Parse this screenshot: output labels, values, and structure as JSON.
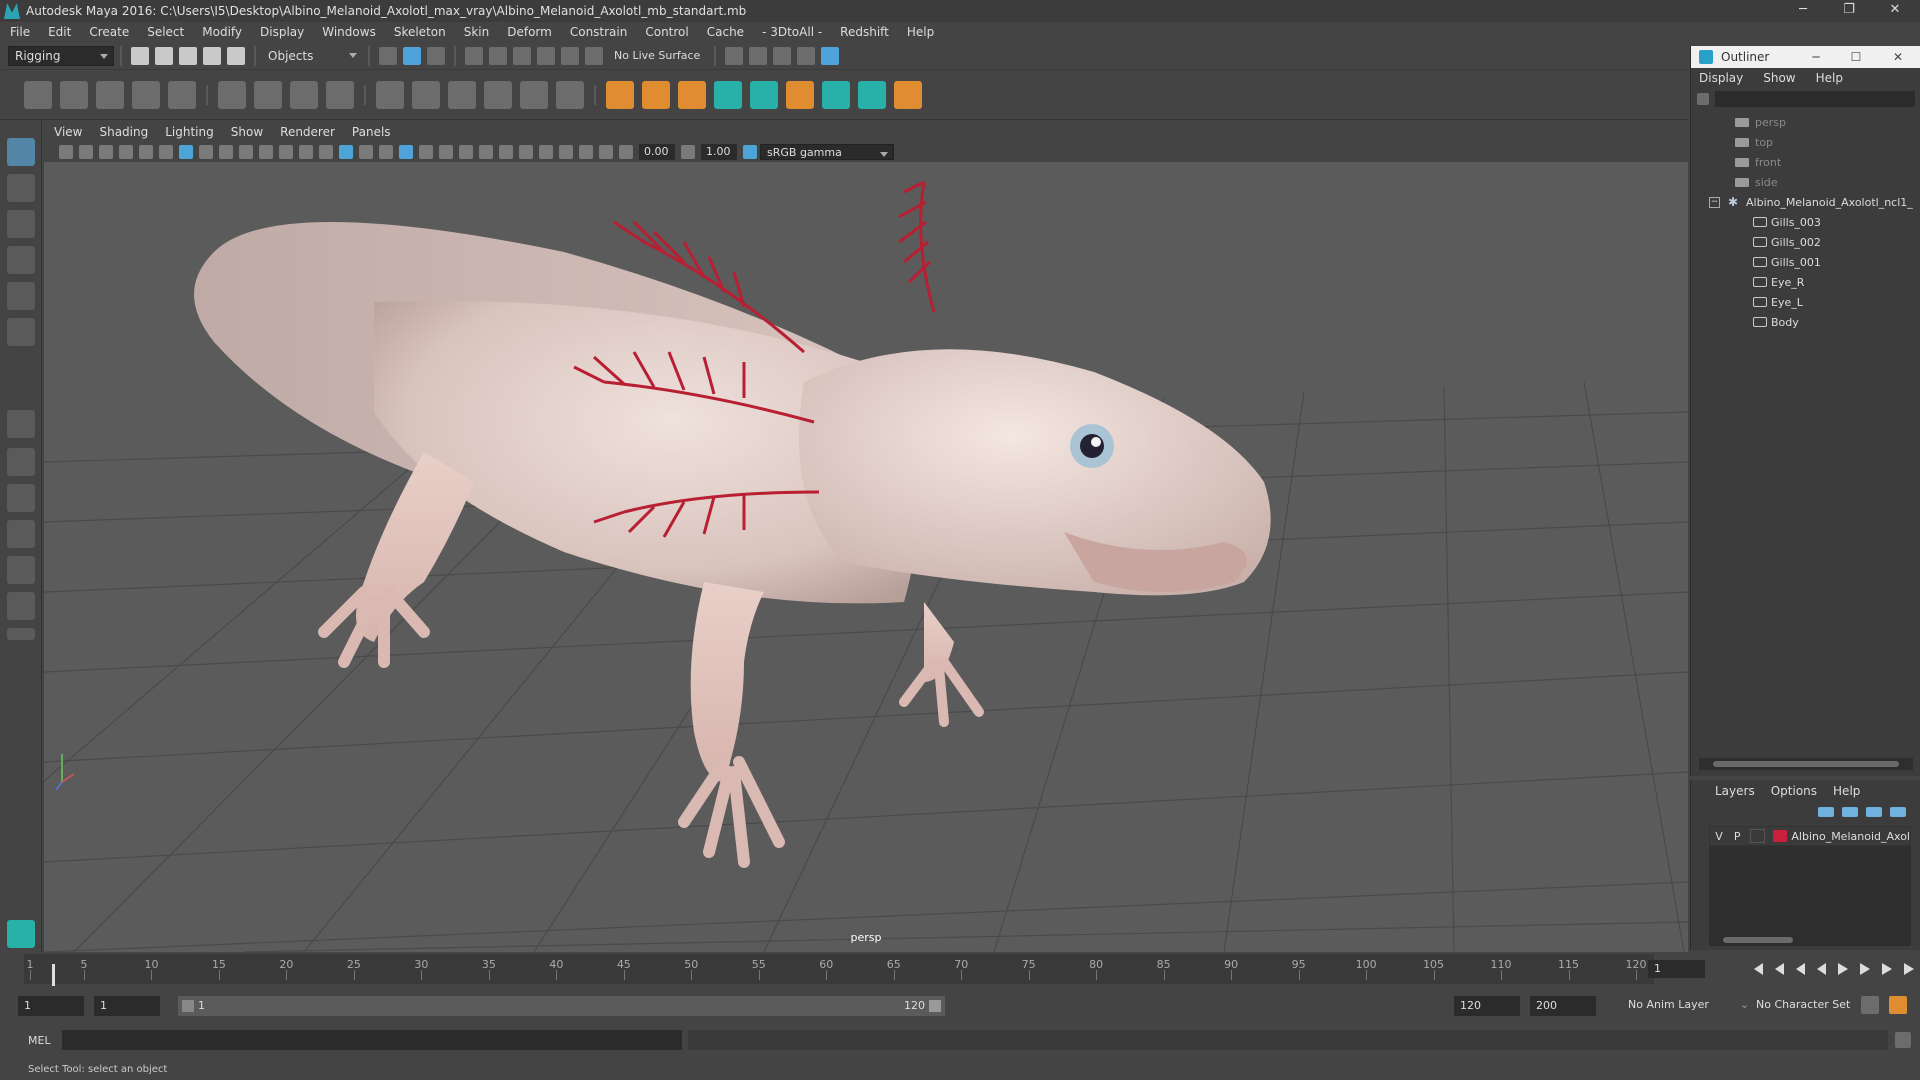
{
  "window": {
    "title": "Autodesk Maya 2016: C:\\Users\\I5\\Desktop\\Albino_Melanoid_Axolotl_max_vray\\Albino_Melanoid_Axolotl_mb_standart.mb",
    "minimize": "─",
    "restore": "❐",
    "close": "✕"
  },
  "menubar": [
    "File",
    "Edit",
    "Create",
    "Select",
    "Modify",
    "Display",
    "Windows",
    "Skeleton",
    "Skin",
    "Deform",
    "Constrain",
    "Control",
    "Cache",
    "- 3DtoAll -",
    "Redshift",
    "Help"
  ],
  "statusline": {
    "menuset": "Rigging",
    "selection_mode": "Objects",
    "live_surface": "No Live Surface"
  },
  "viewport": {
    "menus": [
      "View",
      "Shading",
      "Lighting",
      "Show",
      "Renderer",
      "Panels"
    ],
    "exposure": "0.00",
    "gamma": "1.00",
    "color_space": "sRGB gamma",
    "camera_label": "persp"
  },
  "outliner": {
    "title": "Outliner",
    "menus": [
      "Display",
      "Show",
      "Help"
    ],
    "minimize": "─",
    "maximize": "☐",
    "close": "✕",
    "items": [
      {
        "label": "persp",
        "type": "camera"
      },
      {
        "label": "top",
        "type": "camera"
      },
      {
        "label": "front",
        "type": "camera"
      },
      {
        "label": "side",
        "type": "camera"
      },
      {
        "label": "Albino_Melanoid_Axolotl_ncl1_",
        "type": "group"
      },
      {
        "label": "Gills_003",
        "type": "mesh"
      },
      {
        "label": "Gills_002",
        "type": "mesh"
      },
      {
        "label": "Gills_001",
        "type": "mesh"
      },
      {
        "label": "Eye_R",
        "type": "mesh"
      },
      {
        "label": "Eye_L",
        "type": "mesh"
      },
      {
        "label": "Body",
        "type": "mesh"
      }
    ]
  },
  "layers": {
    "menus": [
      "Layers",
      "Options",
      "Help"
    ],
    "row": {
      "v": "V",
      "p": "P",
      "name": "Albino_Melanoid_Axol",
      "color": "#c8203a"
    }
  },
  "timeline": {
    "ticks": [
      "1",
      "5",
      "10",
      "15",
      "20",
      "25",
      "30",
      "35",
      "40",
      "45",
      "50",
      "55",
      "60",
      "65",
      "70",
      "75",
      "80",
      "85",
      "90",
      "95",
      "100",
      "105",
      "110",
      "115",
      "120"
    ],
    "current_frame": "1"
  },
  "range": {
    "start": "1",
    "playback_start": "1",
    "range_left": "1",
    "range_right": "120",
    "playback_end": "120",
    "end": "200",
    "anim_layer": "No Anim Layer",
    "character_set": "No Character Set"
  },
  "cmdline": {
    "label": "MEL"
  },
  "helpline": "Select Tool: select an object",
  "colors": {
    "accent": "#4ea3d9",
    "axolotl_body": "#e6d3cf",
    "gills": "#b81f33",
    "grid": "#5a5a5a"
  }
}
